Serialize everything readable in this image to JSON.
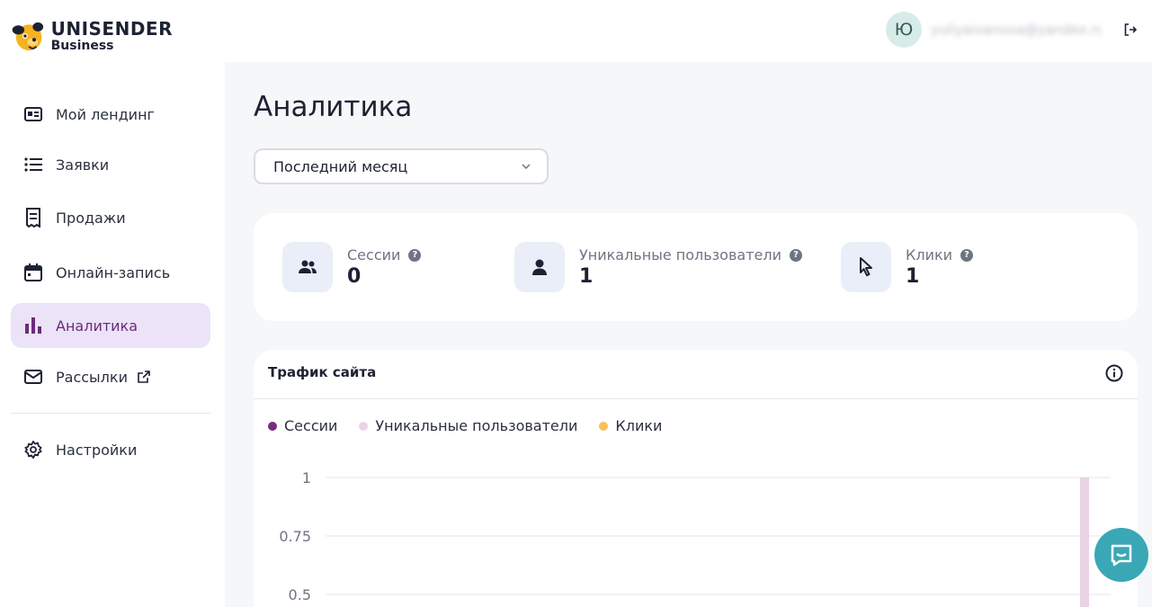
{
  "brand": {
    "name": "UNISENDER",
    "sub": "Business"
  },
  "user": {
    "avatar_letter": "Ю",
    "email": "yuliyaivanova@yandex.ru"
  },
  "sidebar": {
    "items": [
      {
        "label": "Мой лендинг",
        "icon": "landing-icon"
      },
      {
        "label": "Заявки",
        "icon": "list-icon"
      },
      {
        "label": "Продажи",
        "icon": "receipt-icon"
      },
      {
        "label": "Онлайн-запись",
        "icon": "calendar-icon"
      },
      {
        "label": "Аналитика",
        "icon": "bar-chart-icon",
        "active": true
      },
      {
        "label": "Рассылки",
        "icon": "mail-icon",
        "external": true
      },
      {
        "label": "Настройки",
        "icon": "gear-icon"
      }
    ]
  },
  "page": {
    "title": "Аналитика",
    "period": {
      "selected": "Последний месяц"
    }
  },
  "stats": [
    {
      "label": "Сессии",
      "value": "0",
      "icon": "users-group-icon"
    },
    {
      "label": "Уникальные пользователи",
      "value": "1",
      "icon": "user-icon"
    },
    {
      "label": "Клики",
      "value": "1",
      "icon": "cursor-icon"
    }
  ],
  "traffic": {
    "title": "Трафик сайта",
    "legend": [
      {
        "label": "Сессии",
        "color": "#7b2c82"
      },
      {
        "label": "Уникальные пользователи",
        "color": "#ebd3e6"
      },
      {
        "label": "Клики",
        "color": "#f5c15c"
      }
    ]
  },
  "chart_data": {
    "type": "bar",
    "series": [
      {
        "name": "Сессии",
        "values": [
          0
        ]
      },
      {
        "name": "Уникальные пользователи",
        "values": [
          1
        ]
      },
      {
        "name": "Клики",
        "values": [
          1
        ]
      }
    ],
    "y_ticks": [
      "1",
      "0.75",
      "0.5"
    ],
    "ylim": [
      0,
      1
    ],
    "grid": true,
    "legend_position": "top-left"
  },
  "colors": {
    "accent": "#7b2c82",
    "active_bg": "#ece3f8",
    "chat": "#3aa7b6"
  }
}
